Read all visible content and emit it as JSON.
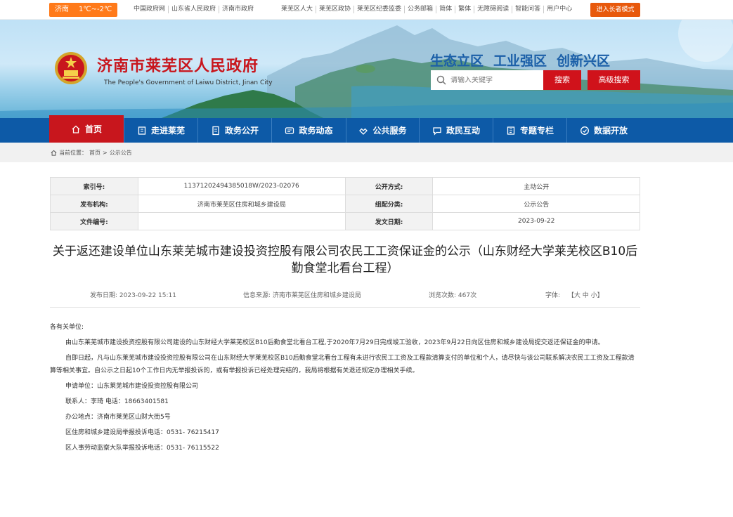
{
  "topbar": {
    "weather_city": "济南",
    "weather_temp": "1℃~-2℃",
    "links_left": [
      "中国政府网",
      "山东省人民政府",
      "济南市政府"
    ],
    "links_right": [
      "莱芜区人大",
      "莱芜区政协",
      "莱芜区纪委监委",
      "公务邮箱",
      "简体",
      "繁体",
      "无障碍阅读",
      "智能问答",
      "用户中心"
    ],
    "elder_mode": "进入长者模式"
  },
  "header": {
    "title": "济南市莱芜区人民政府",
    "subtitle": "The People's Government of Laiwu District, Jinan City",
    "slogans": [
      "生态立区",
      "工业强区",
      "创新兴区"
    ],
    "search_placeholder": "请输入关键字",
    "search_button": "搜索",
    "advanced_search": "高级搜索"
  },
  "nav": {
    "items": [
      {
        "label": "首页",
        "icon": "home-icon"
      },
      {
        "label": "走进莱芜",
        "icon": "building-icon"
      },
      {
        "label": "政务公开",
        "icon": "document-icon"
      },
      {
        "label": "政务动态",
        "icon": "news-icon"
      },
      {
        "label": "公共服务",
        "icon": "service-icon"
      },
      {
        "label": "政民互动",
        "icon": "chat-icon"
      },
      {
        "label": "专题专栏",
        "icon": "book-icon"
      },
      {
        "label": "数据开放",
        "icon": "data-icon"
      }
    ]
  },
  "breadcrumb": {
    "prefix": "当前位置：",
    "home": "首页",
    "sep": ">",
    "current": "公示公告"
  },
  "meta": {
    "index_label": "索引号:",
    "index_value": "11371202494385018W/2023-02076",
    "open_label": "公开方式:",
    "open_value": "主动公开",
    "org_label": "发布机构:",
    "org_value": "济南市莱芜区住房和城乡建设局",
    "category_label": "组配分类:",
    "category_value": "公示公告",
    "file_label": "文件编号:",
    "file_value": "",
    "date_label": "发文日期:",
    "date_value": "2023-09-22"
  },
  "article": {
    "title": "关于返还建设单位山东莱芜城市建设投资控股有限公司农民工工资保证金的公示（山东财经大学莱芜校区B10后勤食堂北看台工程）",
    "publish": "发布日期:  2023-09-22 15:11",
    "source": "信息来源:  济南市莱芜区住房和城乡建设局",
    "views": "浏览次数:  467次",
    "font_label": "字体:",
    "font_sizes": "【大 中 小】",
    "greeting": "各有关单位:",
    "para1": "由山东莱芜城市建设投资控股有限公司建设的山东财经大学莱芜校区B10后勤食堂北看台工程,于2020年7月29日完成竣工验收，2023年9月22日向区住房和城乡建设局提交返还保证金的申请。",
    "para2": "自即日起，凡与山东莱芜城市建设投资控股有限公司在山东财经大学莱芜校区B10后勤食堂北看台工程有未进行农民工工资及工程款清算支付的单位和个人，请尽快与该公司联系解决农民工工资及工程款清算等相关事宜。自公示之日起10个工作日内无举报投诉的，或有举报投诉已经处理完结的，我局将根据有关退还规定办理相关手续。",
    "applicant": "申请单位：山东莱芜城市建设投资控股有限公司",
    "contact": "联系人：李琦 电话：18663401581",
    "address": "办公地点：济南市莱芜区山财大街5号",
    "complaint1": "区住房和城乡建设局举报投诉电话：0531- 76215417",
    "complaint2": "区人事劳动监察大队举报投诉电话：0531- 76115522"
  },
  "colors": {
    "brand_red": "#c8161d",
    "nav_blue": "#0d5aa7",
    "weather_orange": "#ff7a1a"
  }
}
